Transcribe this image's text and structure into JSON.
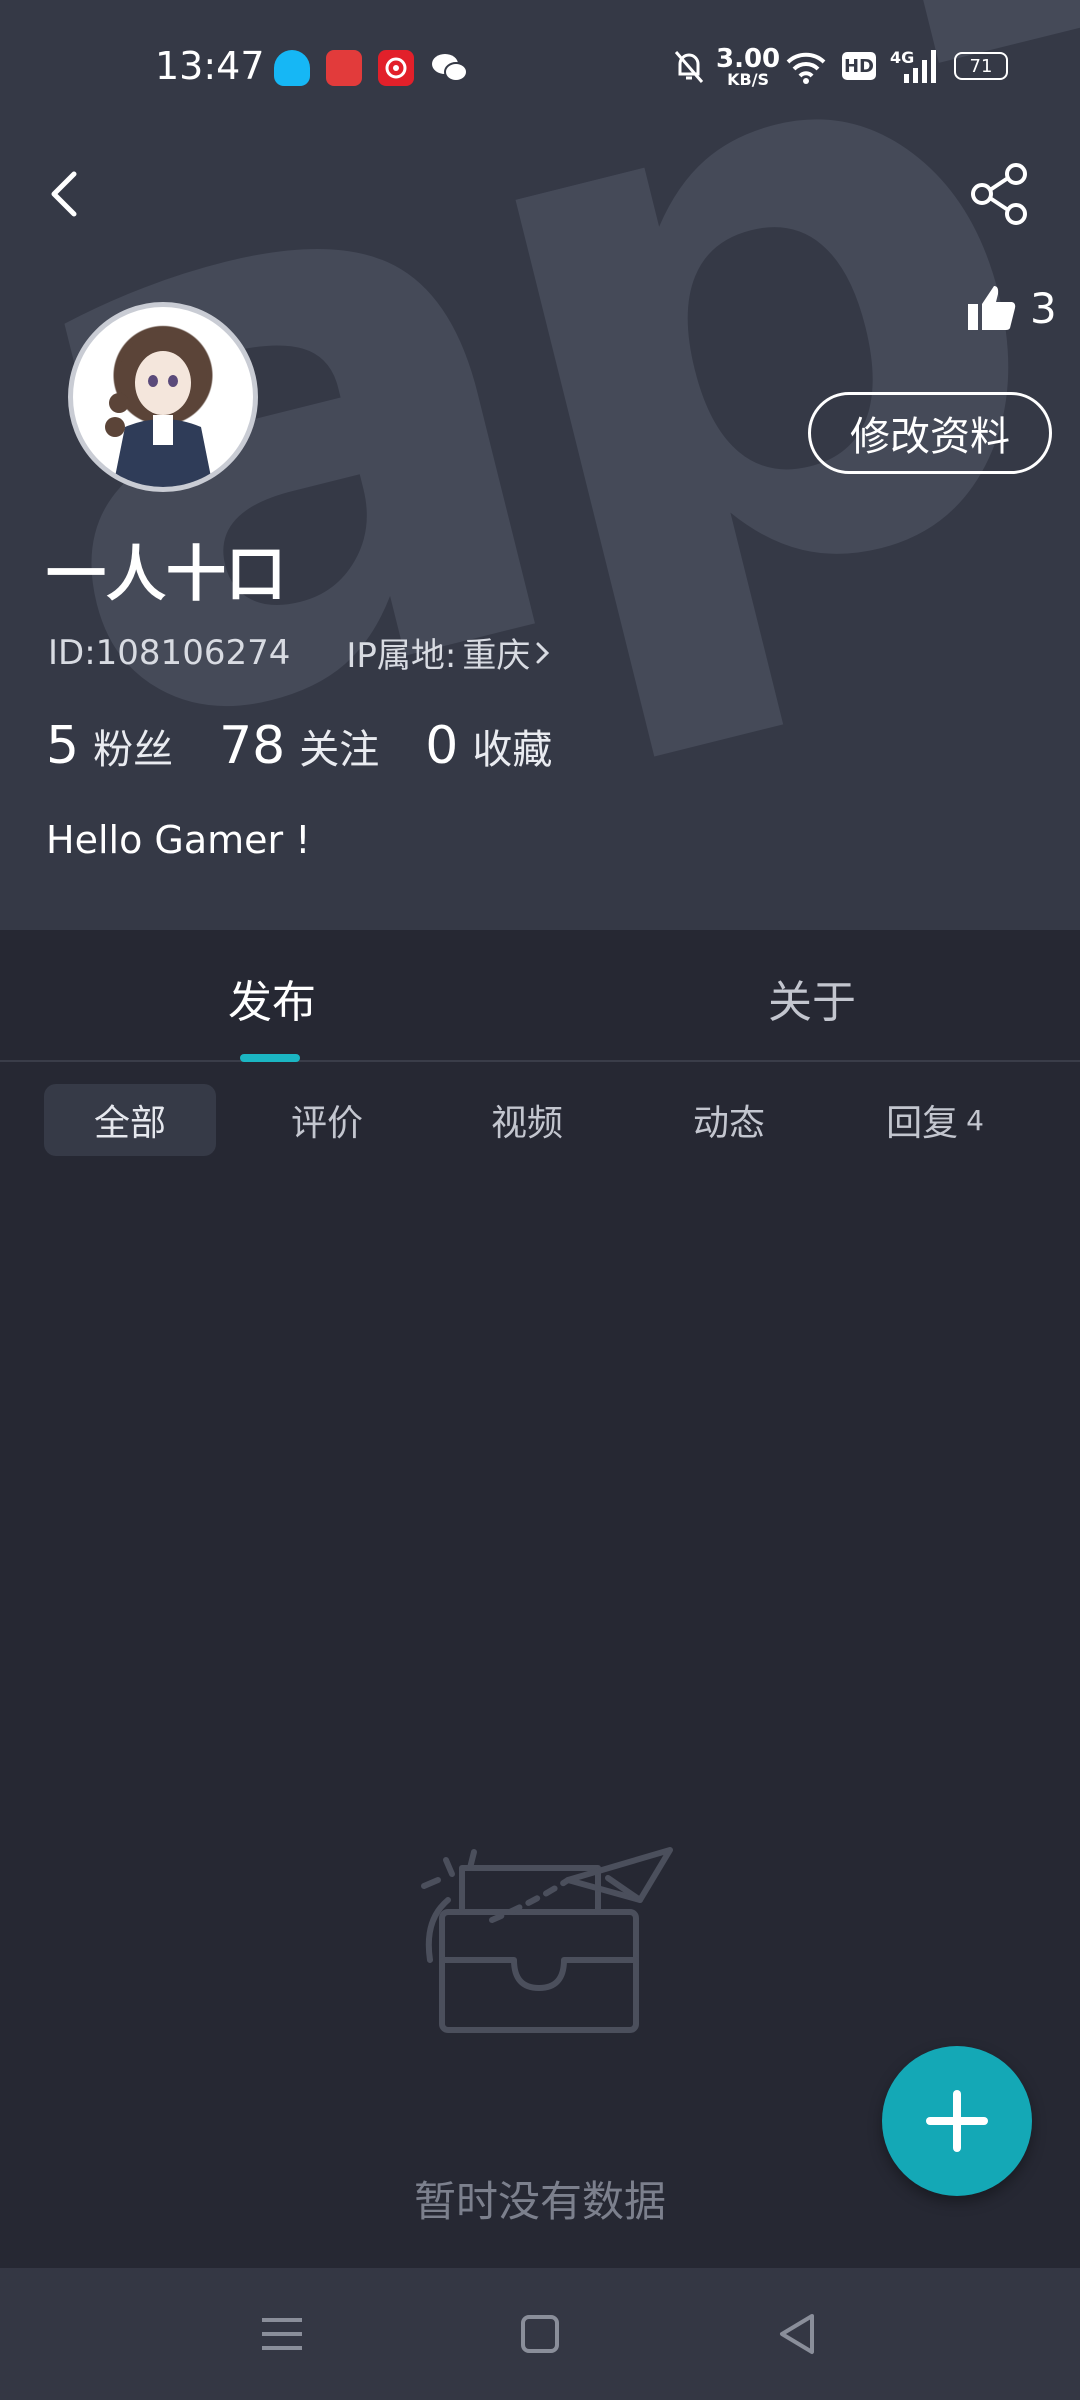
{
  "status_bar": {
    "time": "13:47",
    "net_speed_value": "3.00",
    "net_speed_unit": "KB/S",
    "hd_label": "HD",
    "network_label": "4G",
    "battery": "71"
  },
  "profile": {
    "likes": "3",
    "edit_label": "修改资料",
    "username": "一人十口",
    "id_text": "ID:108106274",
    "ip_label": "IP属地:",
    "ip_value": "重庆",
    "stats": [
      {
        "num": "5",
        "label": "粉丝"
      },
      {
        "num": "78",
        "label": "关注"
      },
      {
        "num": "0",
        "label": "收藏"
      }
    ],
    "bio": "Hello Gamer !",
    "watermark_text": "apTap"
  },
  "tabs": [
    {
      "label": "发布"
    },
    {
      "label": "关于"
    }
  ],
  "filters": [
    {
      "label": "全部"
    },
    {
      "label": "评价"
    },
    {
      "label": "视频"
    },
    {
      "label": "动态"
    },
    {
      "label": "回复",
      "count": "4"
    }
  ],
  "empty_state": {
    "text": "暂时没有数据"
  },
  "colors": {
    "header_bg": "#353946",
    "page_bg": "#262833",
    "accent": "#14a8b6",
    "indicator": "#1bb6c3"
  }
}
